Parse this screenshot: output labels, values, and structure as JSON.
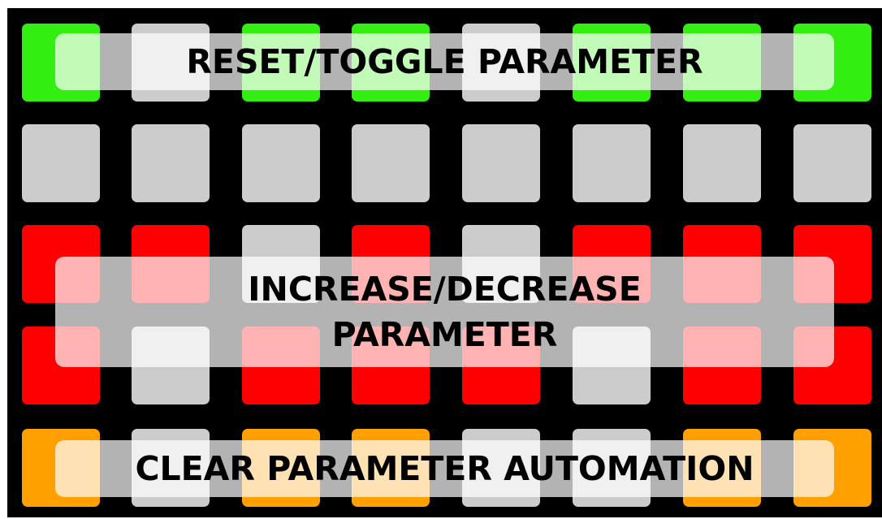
{
  "colors": {
    "green": "#33ee11",
    "gray": "#cccccc",
    "red": "#ff0000",
    "orange": "#ff9f00",
    "background": "#000000"
  },
  "grid": {
    "rows": [
      [
        "green",
        "gray",
        "green",
        "green",
        "gray",
        "green",
        "green",
        "green"
      ],
      [
        "gray",
        "gray",
        "gray",
        "gray",
        "gray",
        "gray",
        "gray",
        "gray"
      ],
      [
        "red",
        "red",
        "gray",
        "red",
        "gray",
        "red",
        "red",
        "red"
      ],
      [
        "red",
        "gray",
        "red",
        "red",
        "red",
        "gray",
        "red",
        "red"
      ],
      [
        "orange",
        "gray",
        "orange",
        "orange",
        "gray",
        "gray",
        "orange",
        "orange"
      ]
    ]
  },
  "labels": {
    "reset_toggle": "RESET/TOGGLE PARAMETER",
    "increase_decrease": "INCREASE/DECREASE\nPARAMETER",
    "clear_automation": "CLEAR PARAMETER AUTOMATION"
  }
}
